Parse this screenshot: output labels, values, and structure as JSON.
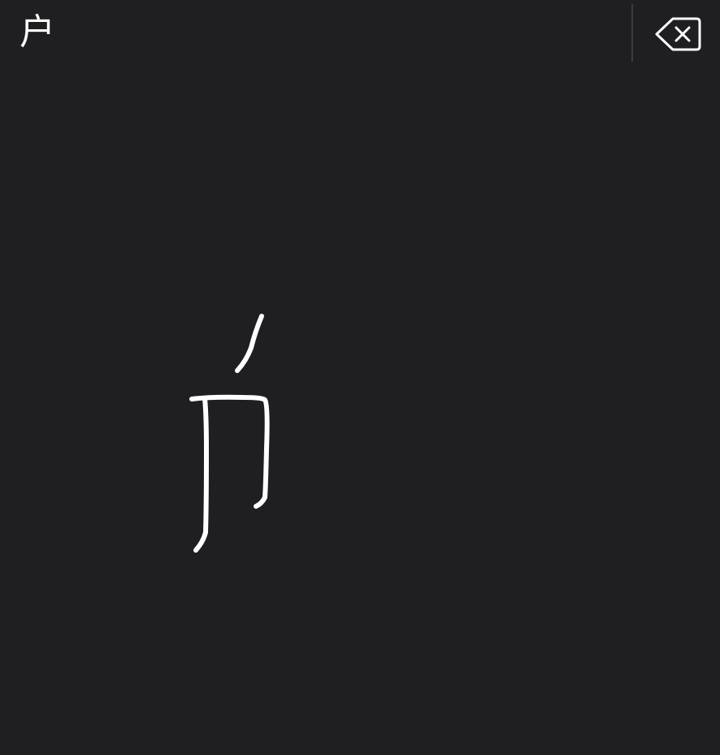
{
  "keyboard": {
    "mode": "handwriting",
    "candidates": [
      "户"
    ],
    "delete_icon": "backspace-icon",
    "ink_color": "#ffffff",
    "background_color": "#1f1e20",
    "divider_color": "#3c3b3e",
    "strokes_drawn": 3
  }
}
